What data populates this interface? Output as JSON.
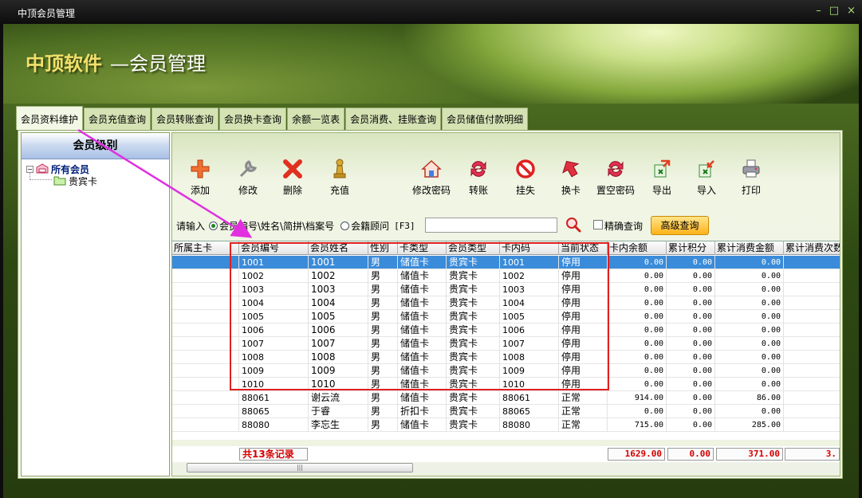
{
  "window": {
    "title": "中顶会员管理",
    "controls": [
      "–",
      "□",
      "×"
    ]
  },
  "banner": {
    "brand": "中顶软件",
    "subtitle": "—会员管理"
  },
  "tabs": [
    {
      "label": "会员资料维护",
      "active": true
    },
    {
      "label": "会员充值查询"
    },
    {
      "label": "会员转账查询"
    },
    {
      "label": "会员换卡查询"
    },
    {
      "label": "余额一览表"
    },
    {
      "label": "会员消费、挂账查询"
    },
    {
      "label": "会员储值付款明细"
    }
  ],
  "tree": {
    "header": "会员级别",
    "root": {
      "label": "所有会员",
      "expander": "−"
    },
    "child": {
      "label": "贵宾卡"
    }
  },
  "toolbar": {
    "add": "添加",
    "edit": "修改",
    "delete": "删除",
    "recharge": "充值",
    "change_password": "修改密码",
    "transfer": "转账",
    "report_loss": "挂失",
    "change_card": "换卡",
    "clear_password": "置空密码",
    "export": "导出",
    "import": "导入",
    "print": "打印"
  },
  "search": {
    "prompt": "请输入",
    "option_member": "会员编号\\姓名\\简拼\\档案号",
    "option_advisor": "会籍顾问",
    "shortcut": "[F3]",
    "input_value": "",
    "exact_label": "精确查询",
    "advanced_button": "高级查询"
  },
  "table": {
    "columns": [
      "所属主卡",
      "会员编号",
      "会员姓名",
      "性别",
      "卡类型",
      "会员类型",
      "卡内码",
      "当前状态",
      "卡内余额",
      "累计积分",
      "累计消费金额",
      "累计消费次数"
    ],
    "rows": [
      [
        "",
        "1001",
        "1001",
        "男",
        "储值卡",
        "贵宾卡",
        "1001",
        "停用",
        "0.00",
        "0.00",
        "0.00",
        "0."
      ],
      [
        "",
        "1002",
        "1002",
        "男",
        "储值卡",
        "贵宾卡",
        "1002",
        "停用",
        "0.00",
        "0.00",
        "0.00",
        "0."
      ],
      [
        "",
        "1003",
        "1003",
        "男",
        "储值卡",
        "贵宾卡",
        "1003",
        "停用",
        "0.00",
        "0.00",
        "0.00",
        "0."
      ],
      [
        "",
        "1004",
        "1004",
        "男",
        "储值卡",
        "贵宾卡",
        "1004",
        "停用",
        "0.00",
        "0.00",
        "0.00",
        "0."
      ],
      [
        "",
        "1005",
        "1005",
        "男",
        "储值卡",
        "贵宾卡",
        "1005",
        "停用",
        "0.00",
        "0.00",
        "0.00",
        "0."
      ],
      [
        "",
        "1006",
        "1006",
        "男",
        "储值卡",
        "贵宾卡",
        "1006",
        "停用",
        "0.00",
        "0.00",
        "0.00",
        "0."
      ],
      [
        "",
        "1007",
        "1007",
        "男",
        "储值卡",
        "贵宾卡",
        "1007",
        "停用",
        "0.00",
        "0.00",
        "0.00",
        "0."
      ],
      [
        "",
        "1008",
        "1008",
        "男",
        "储值卡",
        "贵宾卡",
        "1008",
        "停用",
        "0.00",
        "0.00",
        "0.00",
        "0."
      ],
      [
        "",
        "1009",
        "1009",
        "男",
        "储值卡",
        "贵宾卡",
        "1009",
        "停用",
        "0.00",
        "0.00",
        "0.00",
        "0."
      ],
      [
        "",
        "1010",
        "1010",
        "男",
        "储值卡",
        "贵宾卡",
        "1010",
        "停用",
        "0.00",
        "0.00",
        "0.00",
        "0."
      ],
      [
        "",
        "88061",
        "谢云流",
        "男",
        "储值卡",
        "贵宾卡",
        "88061",
        "正常",
        "914.00",
        "0.00",
        "86.00",
        "1."
      ],
      [
        "",
        "88065",
        "于睿",
        "男",
        "折扣卡",
        "贵宾卡",
        "88065",
        "正常",
        "0.00",
        "0.00",
        "0.00",
        "0."
      ],
      [
        "",
        "88080",
        "李忘生",
        "男",
        "储值卡",
        "贵宾卡",
        "88080",
        "正常",
        "715.00",
        "0.00",
        "285.00",
        "2."
      ]
    ],
    "selected_row": 0
  },
  "footer": {
    "record_count": "共13条记录",
    "total_balance": "1629.00",
    "total_points": "0.00",
    "total_consumption": "371.00",
    "total_times": "3."
  },
  "scrollbar": {
    "grip": "|||"
  },
  "colors": {
    "accent_red": "#e02020",
    "arrow_magenta": "#e030e0",
    "selection": "#3a8bd9",
    "total_text": "#d40000"
  }
}
